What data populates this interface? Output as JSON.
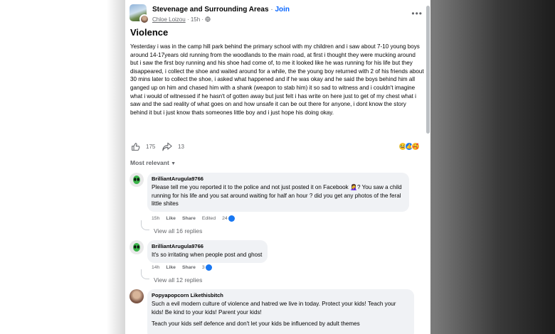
{
  "post": {
    "group_name": "Stevenage and Surrounding Areas",
    "join_label": "Join",
    "author": "Chloe Loizou",
    "time": "15h",
    "title": "Violence",
    "body": "Yesterday i was in the camp hill park behind the primary school with my children and i saw about 7-10 young boys around 14-17years old running from the woodlands to the main road, at first i thought they were mucking around but i saw the first boy running and his shoe had come of, to me it looked like he was running for his life but they disappeared, i collect the shoe and waited around for a while, the the young boy returned with 2 of his friends about 30 mins later to collect the shoe, i asked what happened and if he was okay and he said the boys behind him all ganged up on him and chased him with a shank (weapon to stab him) it so sad to witness and i couldn't imagine what i would of witnessed if he hasn't of gotten away but just felt i has write on here just to get of my chest what i saw and the sad reality of what goes on and how unsafe it can be out there for anyone, i dont know the story behind it but i just know thats someones little boy and i just hope his doing okay.",
    "like_count": "175",
    "share_count": "13"
  },
  "comments_header": "Most relevant",
  "comments": [
    {
      "name": "BrilliantArugula9766",
      "text": "Please tell me you reported it to the police and not just posted it on Facebook 🤦‍♀️? You saw a child running for his life and you sat around waiting for half an hour ? did you get any photos of the feral little shites",
      "time": "15h",
      "like_label": "Like",
      "share_label": "Share",
      "edited_label": "Edited",
      "reactions": "24",
      "view_all": "View all 16 replies"
    },
    {
      "name": "BrilliantArugula9766",
      "text": "It's so irritating when people post and ghost",
      "time": "14h",
      "like_label": "Like",
      "share_label": "Share",
      "reactions": "3",
      "view_all": "View all 12 replies"
    },
    {
      "name": "Popyapopcorn Likethisbitch",
      "text": "Such a evil modern culture of violence and hatred we live in today. Protect your kids! Teach your kids! Be kind to your kids! Parent your kids!",
      "text2": "Teach your kids self defence and don't let your kids be influenced by adult themes"
    }
  ],
  "colors": {
    "link_blue": "#0866ff",
    "bubble_bg": "#f0f2f5",
    "meta_gray": "#65676b"
  },
  "icons": [
    "more-icon",
    "globe-icon",
    "like-icon",
    "share-icon",
    "chevron-down-icon"
  ]
}
